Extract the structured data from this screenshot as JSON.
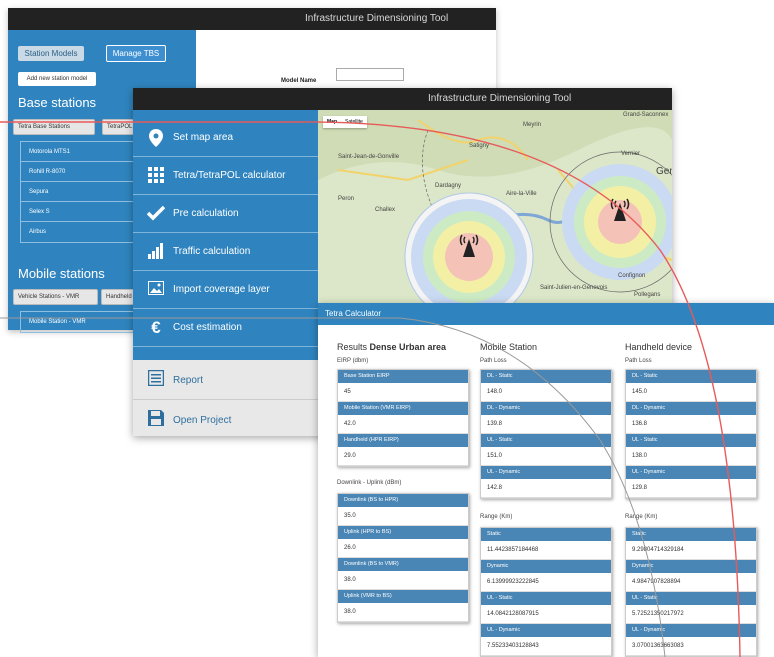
{
  "window1": {
    "title": "Infrastructure Dimensioning Tool",
    "tabs": [
      "Station Models",
      "Manage TBS"
    ],
    "add_button": "Add new station model",
    "base_heading": "Base stations",
    "base_buttons": [
      "Tetra Base Stations",
      "TetraPOL"
    ],
    "base_list": [
      "Motorola MTS1",
      "Rohill R-8070",
      "Sepura",
      "Selex S",
      "Airbus"
    ],
    "mobile_heading": "Mobile stations",
    "mobile_buttons": [
      "Vehicle Stations - VMR",
      "Handheld"
    ],
    "mobile_list": [
      "Mobile Station - VMR"
    ],
    "model_name_label": "Model Name"
  },
  "window2": {
    "title": "Infrastructure Dimensioning Tool",
    "menu": [
      {
        "icon": "map-pin-icon",
        "label": "Set map area"
      },
      {
        "icon": "grid-icon",
        "label": "Tetra/TetraPOL calculator"
      },
      {
        "icon": "checkmark-icon",
        "label": "Pre calculation"
      },
      {
        "icon": "bar-chart-icon",
        "label": "Traffic calculation"
      },
      {
        "icon": "image-icon",
        "label": "Import coverage layer"
      },
      {
        "icon": "euro-icon",
        "label": "Cost estimation"
      },
      {
        "icon": "report-icon",
        "label": "Report"
      },
      {
        "icon": "save-icon",
        "label": "Open Project"
      }
    ],
    "map_tabs": [
      "Map",
      "Satellite"
    ],
    "map_labels": [
      "Meyrin",
      "Grand-Saconnex",
      "Satigny",
      "Vernier",
      "Gen",
      "Saint-Jean-de-Gonville",
      "Dardagny",
      "Aire-la-Ville",
      "Peron",
      "Challex",
      "Confignon",
      "Saint-Julien-en-Genevois",
      "Pollegans"
    ]
  },
  "window3": {
    "title": "Tetra Calculator",
    "col1": {
      "title_prefix": "Results",
      "title_bold": "Dense Urban area",
      "eirp_label": "EIRP (dbm)",
      "eirp": [
        {
          "label": "Base Station EIRP",
          "value": "45"
        },
        {
          "label": "Mobile Station (VMR EIRP)",
          "value": "42.0"
        },
        {
          "label": "Handheld (HPR EIRP)",
          "value": "29.0"
        }
      ],
      "dl_ul_label": "Downlink - Uplink (dBm)",
      "dl_ul": [
        {
          "label": "Downlink (BS to HPR)",
          "value": "35.0"
        },
        {
          "label": "Uplink (HPR to BS)",
          "value": "26.0"
        },
        {
          "label": "Downlink (BS to VMR)",
          "value": "38.0"
        },
        {
          "label": "Uplink (VMR to BS)",
          "value": "38.0"
        }
      ]
    },
    "col2": {
      "title": "Mobile Station",
      "pl_label": "Path Loss",
      "path_loss": [
        {
          "label": "DL - Static",
          "value": "148.0"
        },
        {
          "label": "DL - Dynamic",
          "value": "139.8"
        },
        {
          "label": "UL - Static",
          "value": "151.0"
        },
        {
          "label": "UL - Dynamic",
          "value": "142.8"
        }
      ],
      "range_label": "Range (Km)",
      "range": [
        {
          "label": "Static",
          "value": "11.4423857184468"
        },
        {
          "label": "Dynamic",
          "value": "6.13999923222845"
        },
        {
          "label": "UL - Static",
          "value": "14.0842128087915"
        },
        {
          "label": "UL - Dynamic",
          "value": "7.55233403128843"
        }
      ]
    },
    "col3": {
      "title": "Handheld device",
      "pl_label": "Path Loss",
      "path_loss": [
        {
          "label": "DL - Static",
          "value": "145.0"
        },
        {
          "label": "DL - Dynamic",
          "value": "136.8"
        },
        {
          "label": "UL - Static",
          "value": "138.0"
        },
        {
          "label": "UL - Dynamic",
          "value": "129.8"
        }
      ],
      "range_label": "Range (Km)",
      "range": [
        {
          "label": "Static",
          "value": "9.29804714329184"
        },
        {
          "label": "Dynamic",
          "value": "4.9847907828894"
        },
        {
          "label": "UL - Static",
          "value": "5.72521350217972"
        },
        {
          "label": "UL - Dynamic",
          "value": "3.07001363663083"
        }
      ]
    }
  }
}
